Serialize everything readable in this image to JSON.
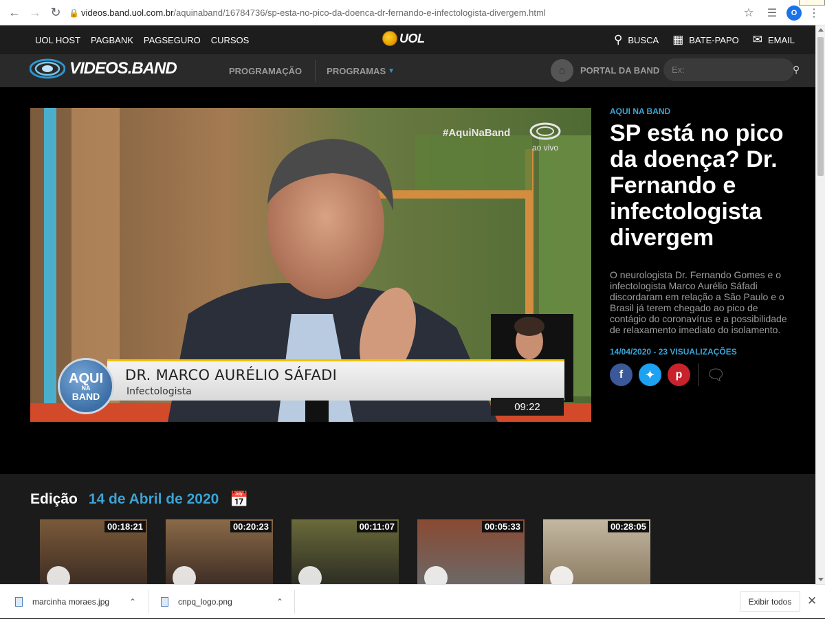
{
  "browser": {
    "url_host": "videos.band.uol.com.br",
    "url_path": "/aquinaband/16784736/sp-esta-no-pico-da-doenca-dr-fernando-e-infectologista-divergem.html",
    "profile_initial": "O"
  },
  "uol_bar": {
    "links": [
      "UOL HOST",
      "PAGBANK",
      "PAGSEGURO",
      "CURSOS"
    ],
    "logo_text": "UOL",
    "busca": "BUSCA",
    "bate_papo": "BATE-PAPO",
    "email": "EMAIL"
  },
  "band_header": {
    "logo_text": "VIDEOS.BAND",
    "programacao": "PROGRAMAÇÃO",
    "programas": "PROGRAMAS",
    "portal": "PORTAL DA BAND",
    "search_placeholder": "Ex:"
  },
  "player": {
    "hashtag": "#AquiNaBand",
    "live_label": "ao vivo",
    "badge_line1": "AQUI",
    "badge_line2": "NA",
    "badge_line3": "BAND",
    "guest_name": "DR. MARCO AURÉLIO SÁFADI",
    "guest_role": "Infectologista",
    "timecode": "09:22"
  },
  "article": {
    "kicker": "AQUI NA BAND",
    "headline": "SP está no pico da doença? Dr. Fernando e infectologista divergem",
    "description": "O neurologista Dr. Fernando Gomes e o infectologista Marco Aurélio Sáfadi discordaram em relação a São Paulo e o Brasil já terem chegado ao pico de contágio do coronavírus e a possibilidade de relaxamento imediato do isolamento.",
    "meta": "14/04/2020 - 23 VISUALIZAÇÕES"
  },
  "edition": {
    "label": "Edição",
    "date": "14 de Abril de 2020",
    "thumbs": [
      {
        "duration": "00:18:21"
      },
      {
        "duration": "00:20:23"
      },
      {
        "duration": "00:11:07"
      },
      {
        "duration": "00:05:33"
      },
      {
        "duration": "00:28:05"
      }
    ]
  },
  "downloads": {
    "items": [
      "marcinha moraes.jpg",
      "cnpq_logo.png"
    ],
    "show_all": "Exibir todos"
  },
  "colors": {
    "accent_blue": "#3ba3d5",
    "facebook": "#3b5998",
    "twitter": "#1da1f2",
    "pinterest": "#c8232c"
  }
}
